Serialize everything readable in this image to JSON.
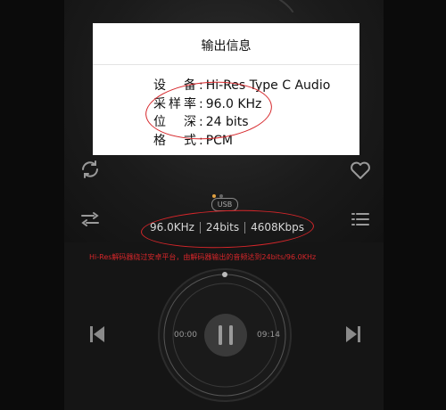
{
  "dialog": {
    "title": "输出信息",
    "rows": [
      {
        "key": "设备",
        "value": "Hi-Res Type C Audio"
      },
      {
        "key": "采样率",
        "value": "96.0 KHz"
      },
      {
        "key": "位深",
        "value": "24 bits"
      },
      {
        "key": "格式",
        "value": "PCM"
      }
    ],
    "separator": ":"
  },
  "badge": {
    "label": "USB"
  },
  "format": {
    "sample_rate": "96.0KHz",
    "bit_depth": "24bits",
    "bitrate": "4608Kbps"
  },
  "annotation": {
    "note": "Hi-Res解码器绕过安卓平台，由解码器输出的音频达到24bits/96.0KHz"
  },
  "player": {
    "elapsed": "00:00",
    "duration": "09:14"
  },
  "pager": {
    "total": 2,
    "active": 1
  },
  "colors": {
    "annotation_red": "#d6262a",
    "page_dot_active": "#e0a040"
  },
  "icons": [
    "repeat-icon",
    "heart-icon",
    "equalizer-icon",
    "playlist-icon",
    "previous-icon",
    "pause-icon",
    "next-icon"
  ]
}
